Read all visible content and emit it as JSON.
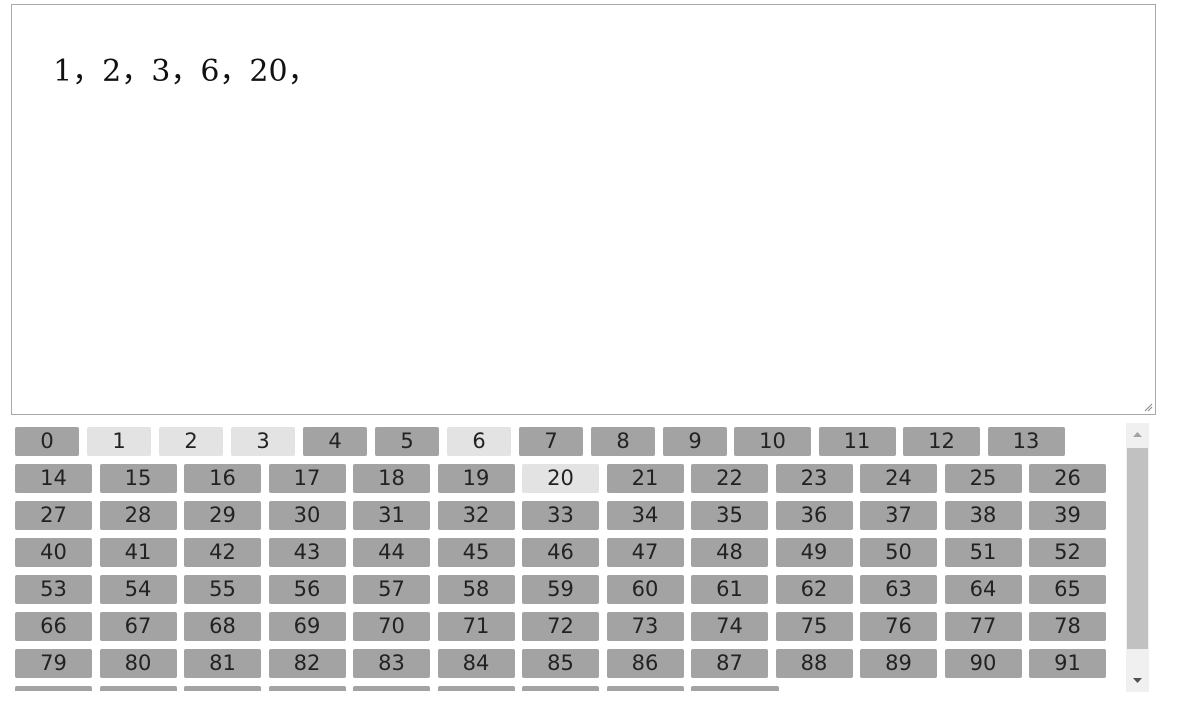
{
  "editor": {
    "text": "1，2，3，6，20，"
  },
  "number_picker": {
    "selected": [
      "1",
      "2",
      "3",
      "6",
      "20"
    ],
    "rows": [
      [
        "0",
        "1",
        "2",
        "3",
        "4",
        "5",
        "6",
        "7",
        "8",
        "9",
        "10",
        "11",
        "12",
        "13"
      ],
      [
        "14",
        "15",
        "16",
        "17",
        "18",
        "19",
        "20",
        "21",
        "22",
        "23",
        "24",
        "25",
        "26"
      ],
      [
        "27",
        "28",
        "29",
        "30",
        "31",
        "32",
        "33",
        "34",
        "35",
        "36",
        "37",
        "38",
        "39"
      ],
      [
        "40",
        "41",
        "42",
        "43",
        "44",
        "45",
        "46",
        "47",
        "48",
        "49",
        "50",
        "51",
        "52"
      ],
      [
        "53",
        "54",
        "55",
        "56",
        "57",
        "58",
        "59",
        "60",
        "61",
        "62",
        "63",
        "64",
        "65"
      ],
      [
        "66",
        "67",
        "68",
        "69",
        "70",
        "71",
        "72",
        "73",
        "74",
        "75",
        "76",
        "77",
        "78"
      ],
      [
        "79",
        "80",
        "81",
        "82",
        "83",
        "84",
        "85",
        "86",
        "87",
        "88",
        "89",
        "90",
        "91"
      ]
    ]
  },
  "scrollbar": {
    "up_icon": "triangle-up-icon",
    "down_icon": "triangle-down-icon"
  }
}
